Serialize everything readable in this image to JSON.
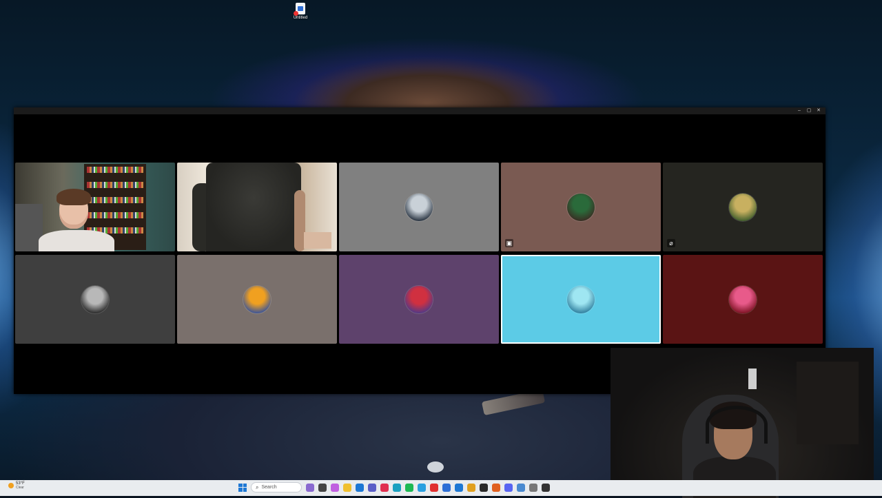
{
  "desktop": {
    "icon_label": "Untitled"
  },
  "window": {
    "controls": [
      "–",
      "▢",
      "✕"
    ]
  },
  "tiles": [
    {
      "id": "p1",
      "type": "video",
      "bg": "#3d5a56"
    },
    {
      "id": "p2",
      "type": "video",
      "bg": "#d8cfc2"
    },
    {
      "id": "p3",
      "type": "avatar",
      "bg": "#808080",
      "avatar_colors": [
        "#c9d1d8",
        "#1f2a38"
      ]
    },
    {
      "id": "p4",
      "type": "avatar",
      "bg": "#7a5a52",
      "avatar_colors": [
        "#2a6a3a",
        "#3a2a22"
      ],
      "status_icon": "screen-share-icon"
    },
    {
      "id": "p5",
      "type": "avatar",
      "bg": "#252520",
      "avatar_colors": [
        "#c8b060",
        "#3a5a2a"
      ],
      "status_icon": "mic-off-icon"
    },
    {
      "id": "p6",
      "type": "avatar",
      "bg": "#3f3f3f",
      "avatar_colors": [
        "#b8b8b8",
        "#222222"
      ]
    },
    {
      "id": "p7",
      "type": "avatar",
      "bg": "#7a706c",
      "avatar_colors": [
        "#f0a020",
        "#3050a0"
      ]
    },
    {
      "id": "p8",
      "type": "avatar",
      "bg": "#5e426c",
      "avatar_colors": [
        "#d03040",
        "#4a3a8a"
      ]
    },
    {
      "id": "p9",
      "type": "avatar",
      "bg": "#5ccbe6",
      "avatar_colors": [
        "#9fe6f2",
        "#2a7a9a"
      ],
      "active": true
    },
    {
      "id": "p10",
      "type": "avatar",
      "bg": "#5a1414",
      "avatar_colors": [
        "#e85a8a",
        "#7a1020"
      ]
    }
  ],
  "taskbar": {
    "weather_temp": "53°F",
    "weather_cond": "Clear",
    "search_placeholder": "Search",
    "apps": [
      "file-explorer-icon",
      "copilot-icon",
      "folder-icon",
      "teams-icon",
      "opera-icon",
      "edge-icon",
      "spotify-icon",
      "settings-icon",
      "store-icon",
      "calculator-icon",
      "youtube-icon",
      "phone-link-icon",
      "chrome-icon",
      "terminal-icon",
      "firefox-icon",
      "discord-icon",
      "snipping-tool-icon",
      "gear-icon",
      "obs-icon"
    ]
  }
}
